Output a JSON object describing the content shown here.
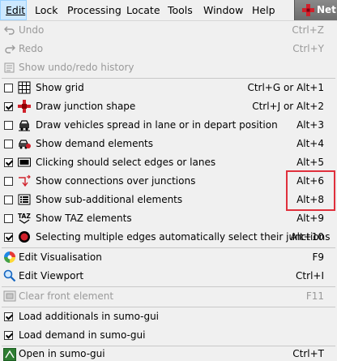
{
  "menubar": {
    "items": [
      "Edit",
      "Lock",
      "Processing",
      "Locate",
      "Tools",
      "Window",
      "Help"
    ],
    "net_button": "Net"
  },
  "menu": {
    "undo": {
      "label": "Undo",
      "shortcut": "Ctrl+Z"
    },
    "redo": {
      "label": "Redo",
      "shortcut": "Ctrl+Y"
    },
    "history": {
      "label": "Show undo/redo history"
    },
    "toggles": [
      {
        "label": "Show grid",
        "shortcut": "Ctrl+G or Alt+1",
        "checked": false,
        "icon": "grid-icon"
      },
      {
        "label": "Draw junction shape",
        "shortcut": "Ctrl+J or Alt+2",
        "checked": true,
        "icon": "junction-shape-icon"
      },
      {
        "label": "Draw vehicles spread in lane or in depart position",
        "shortcut": "Alt+3",
        "checked": false,
        "icon": "vehicle-spread-icon"
      },
      {
        "label": "Show demand elements",
        "shortcut": "Alt+4",
        "checked": false,
        "icon": "demand-elements-icon"
      },
      {
        "label": "Clicking should select edges or lanes",
        "shortcut": "Alt+5",
        "checked": true,
        "icon": "select-edges-icon"
      },
      {
        "label": "Show connections over junctions",
        "shortcut": "Alt+6",
        "checked": false,
        "icon": "connections-icon"
      },
      {
        "label": "Show sub-additional elements",
        "shortcut": "Alt+8",
        "checked": false,
        "icon": "sub-additional-icon"
      },
      {
        "label": "Show TAZ elements",
        "shortcut": "Alt+9",
        "checked": false,
        "icon": "taz-icon"
      },
      {
        "label": "Selecting multiple edges automatically select their junctions",
        "shortcut": "Alt+10",
        "checked": true,
        "icon": "select-junctions-icon"
      }
    ],
    "edit_visualisation": {
      "label": "Edit Visualisation",
      "shortcut": "F9"
    },
    "edit_viewport": {
      "label": "Edit Viewport",
      "shortcut": "Ctrl+I"
    },
    "clear_front": {
      "label": "Clear front element",
      "shortcut": "F11"
    },
    "load_additionals": {
      "label": "Load additionals in sumo-gui",
      "checked": true
    },
    "load_demand": {
      "label": "Load demand in sumo-gui",
      "checked": true
    },
    "open_sumo": {
      "label": "Open in sumo-gui",
      "shortcut": "Ctrl+T"
    }
  },
  "colors": {
    "highlight_box": "#e0303c",
    "menu_bg": "#f0f0f0",
    "active_menu": "#cce8ff"
  }
}
